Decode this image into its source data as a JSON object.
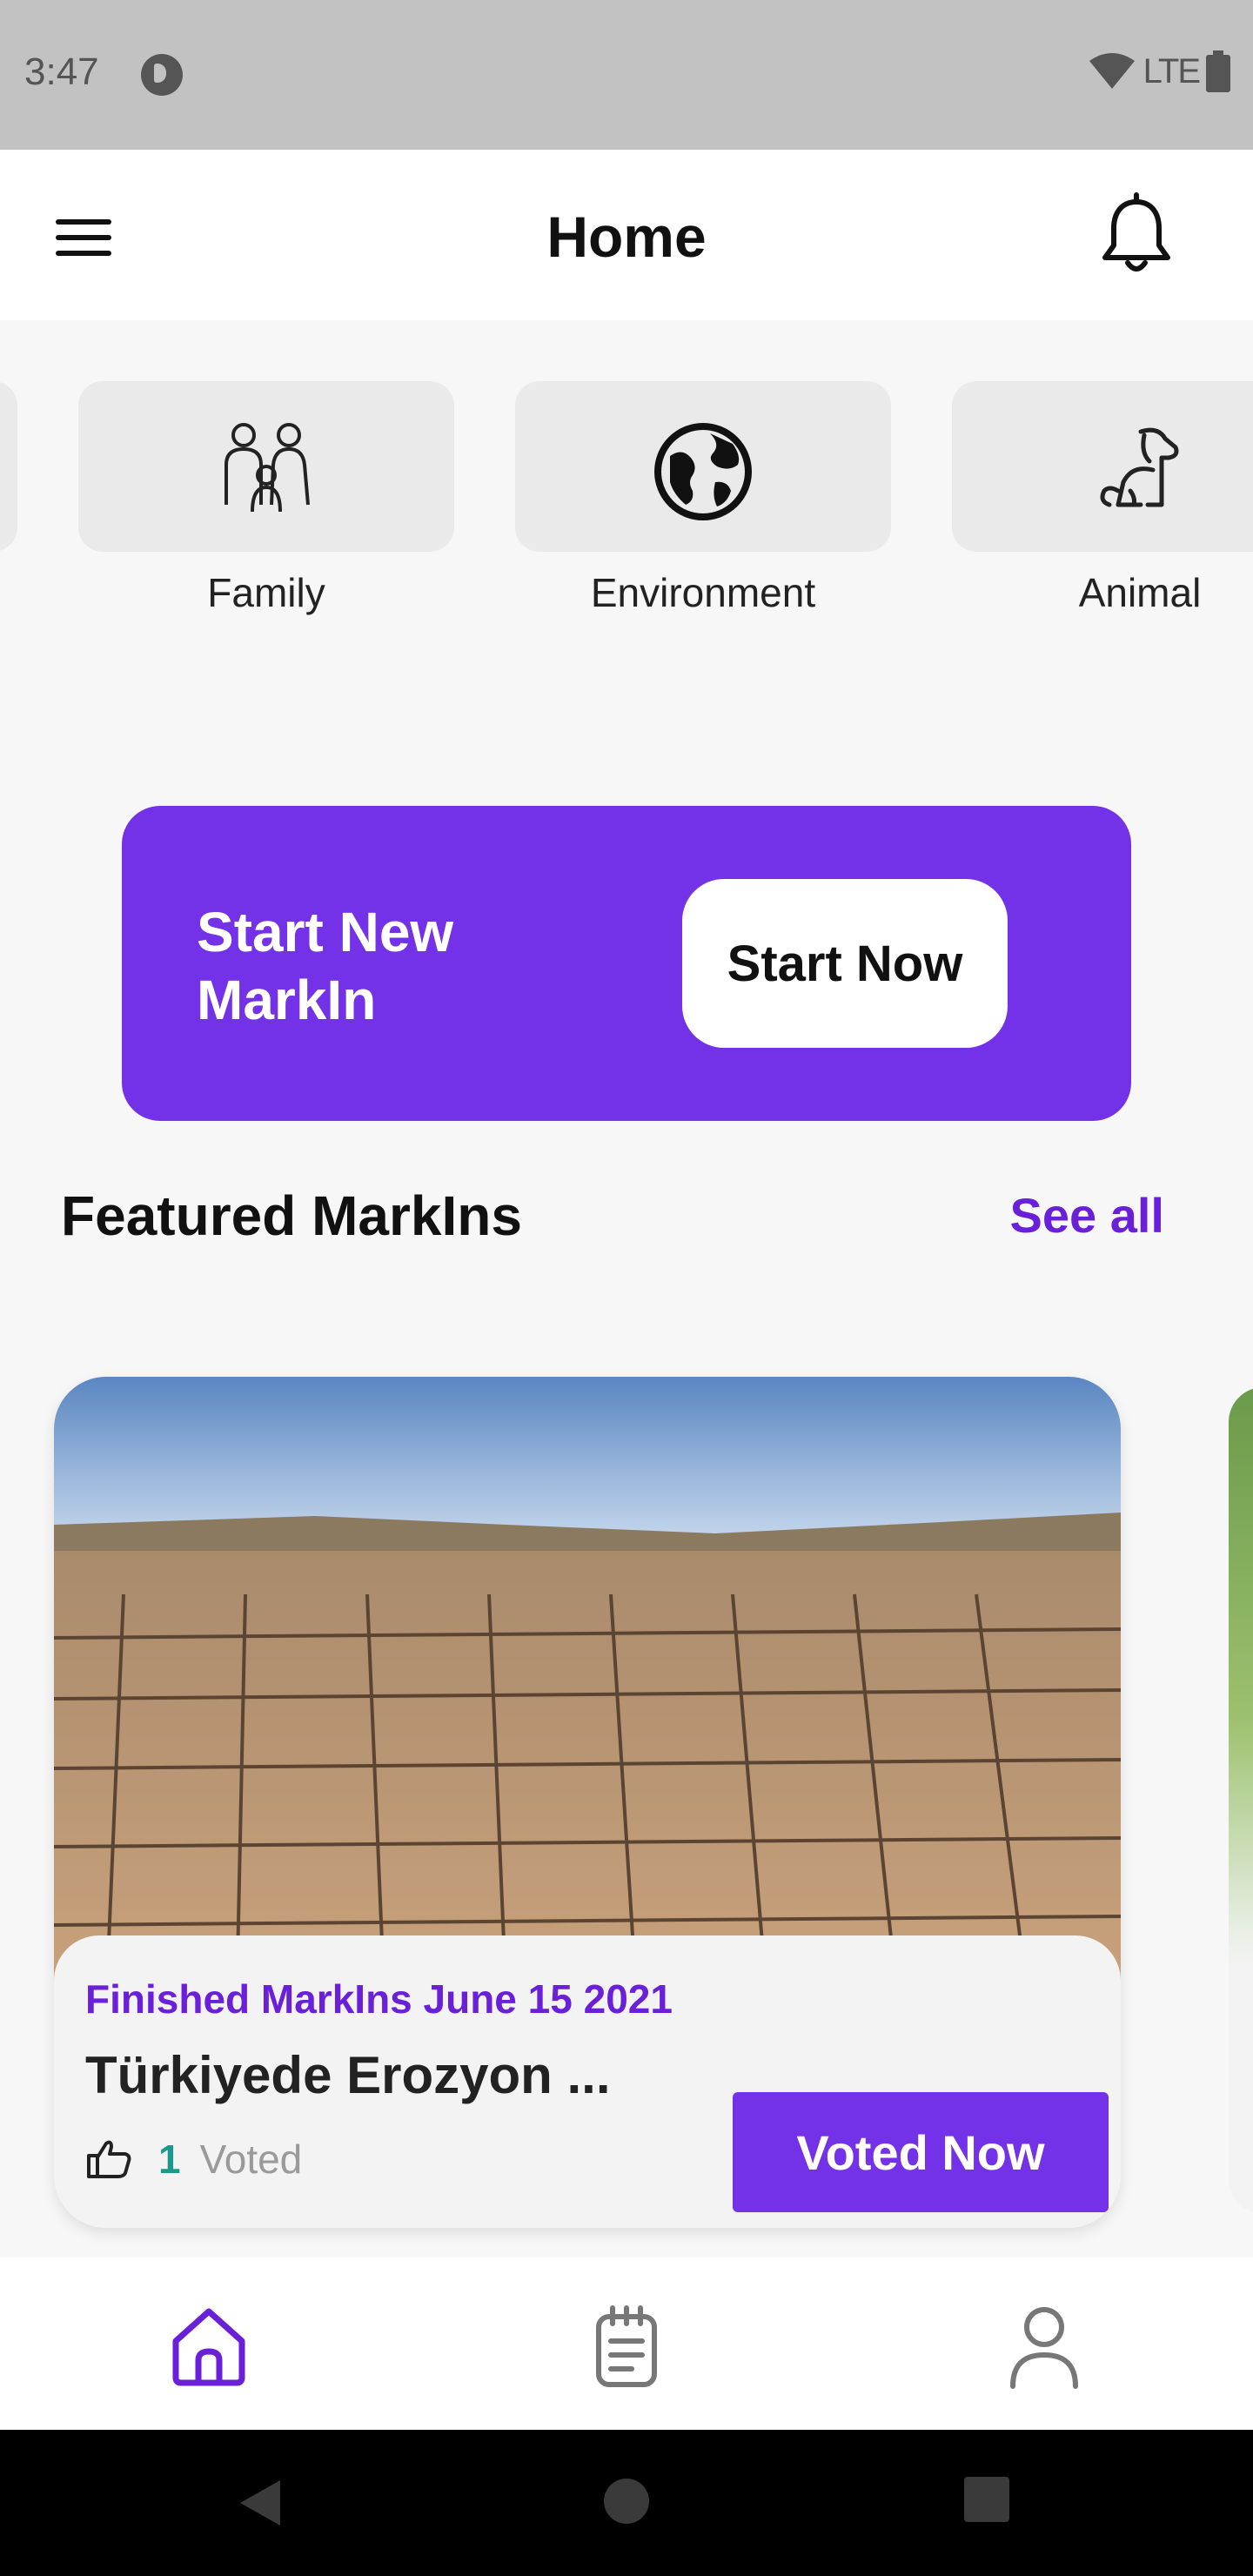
{
  "status_bar": {
    "time": "3:47",
    "network": "LTE"
  },
  "header": {
    "title": "Home"
  },
  "categories": [
    {
      "label": "Family",
      "icon": "family-icon"
    },
    {
      "label": "Environment",
      "icon": "globe-icon"
    },
    {
      "label": "Animal",
      "icon": "dog-icon"
    }
  ],
  "banner": {
    "text": "Start New MarkIn",
    "button_label": "Start Now"
  },
  "featured": {
    "title": "Featured MarkIns",
    "see_all_label": "See all"
  },
  "card": {
    "meta": "Finished MarkIns June 15 2021",
    "title": "Türkiyede Erozyon ...",
    "vote_count": "1",
    "vote_label": "Voted",
    "button_label": "Voted Now"
  },
  "bottom_nav": [
    {
      "name": "home",
      "icon": "home-icon",
      "active": true
    },
    {
      "name": "markins",
      "icon": "notepad-icon",
      "active": false
    },
    {
      "name": "profile",
      "icon": "user-icon",
      "active": false
    }
  ],
  "colors": {
    "accent": "#7432e8",
    "accent_text": "#6a1fd8",
    "vote_count": "#1a9a8a",
    "status_bar": "#c2c2c2"
  }
}
